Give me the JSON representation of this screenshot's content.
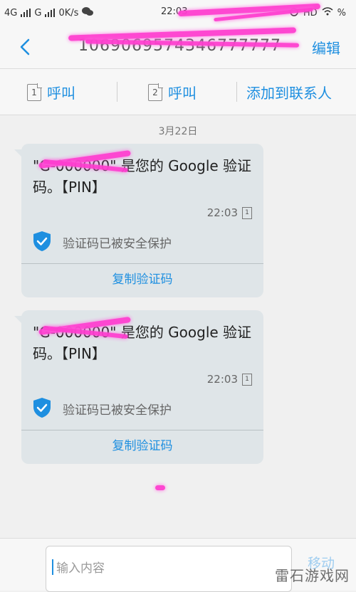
{
  "status": {
    "network1": "4G",
    "network2": "G",
    "speed": "0K/s",
    "time": "22:03",
    "hd": "HD",
    "battery": "%"
  },
  "nav": {
    "title": "1069069574346777777",
    "edit": "编辑"
  },
  "actions": {
    "call1_num": "1",
    "call1": "呼叫",
    "call2_num": "2",
    "call2": "呼叫",
    "add_contact": "添加到联系人"
  },
  "date": "3月22日",
  "messages": [
    {
      "text": "\"G-000000\" 是您的 Google 验证码。【PIN】",
      "time": "22:03",
      "sim": "1",
      "safety": "验证码已被安全保护",
      "copy": "复制验证码"
    },
    {
      "text": "\"G-000000\" 是您的 Google 验证码。【PIN】",
      "time": "22:03",
      "sim": "1",
      "safety": "验证码已被安全保护",
      "copy": "复制验证码"
    }
  ],
  "input": {
    "placeholder": "输入内容",
    "send": "移动"
  },
  "watermark": "雷石游戏网",
  "colors": {
    "accent": "#1e8fe0",
    "bubble": "#dfe5e8",
    "redaction": "#ff3fd0"
  }
}
